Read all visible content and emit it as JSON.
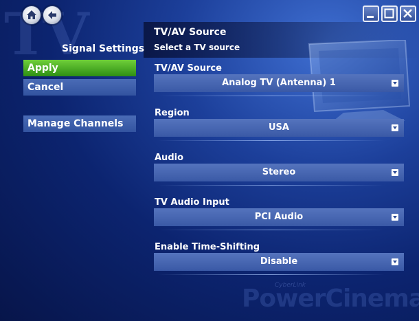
{
  "watermark": "TV",
  "nav": {
    "home_icon": "home-icon",
    "back_icon": "back-arrow-icon"
  },
  "window_controls": [
    "minimize-icon",
    "maximize-icon",
    "close-icon"
  ],
  "sidebar": {
    "title": "Signal Settings",
    "apply_label": "Apply",
    "cancel_label": "Cancel",
    "manage_channels_label": "Manage Channels"
  },
  "header": {
    "title": "TV/AV Source",
    "subtitle": "Select a TV source"
  },
  "settings": [
    {
      "label": "TV/AV Source",
      "value": "Analog TV (Antenna) 1"
    },
    {
      "label": "Region",
      "value": "USA"
    },
    {
      "label": "Audio",
      "value": "Stereo"
    },
    {
      "label": "TV Audio Input",
      "value": "PCI Audio"
    },
    {
      "label": "Enable Time-Shifting",
      "value": "Disable"
    }
  ],
  "brand": {
    "small": "CyberLink",
    "name": "PowerCinema"
  },
  "colors": {
    "accent_active": "#4cb023",
    "button": "#3d5fae",
    "background": "#0c2470"
  }
}
